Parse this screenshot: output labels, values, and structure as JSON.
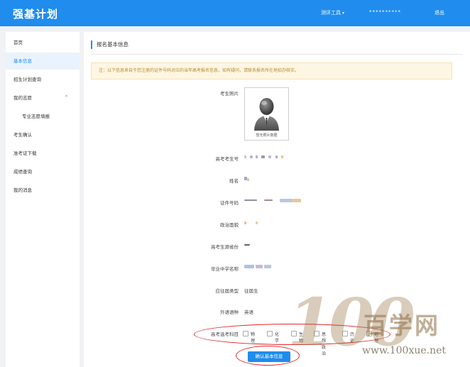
{
  "header": {
    "brand": "强基计划",
    "tools_menu": "测评工具",
    "username": "**********",
    "logout": "退出",
    "bar_color": "#1f8cee"
  },
  "sidebar": {
    "items": [
      {
        "label": "首页"
      },
      {
        "label": "基本信息",
        "active": true
      },
      {
        "label": "招生计划查询"
      },
      {
        "label": "我的志愿"
      },
      {
        "label": "专业志愿填报"
      },
      {
        "label": "考生确认"
      },
      {
        "label": "准考证下载"
      },
      {
        "label": "成绩查询"
      },
      {
        "label": "我的消息"
      }
    ]
  },
  "main": {
    "section_title": "报名基本信息",
    "notice": "注：以下信息来自于您注册的证件号码对应的当年高考报名信息，如有疑问，请联系报名所在地招办核实。",
    "photo": {
      "label": "考生照片",
      "caption": "暂无照片数据",
      "icon": "user-avatar-icon"
    },
    "fields": [
      {
        "label": "高考考生号"
      },
      {
        "label": "姓名"
      },
      {
        "label": "证件号码"
      },
      {
        "label": "政治面貌"
      },
      {
        "label": "高考生源省份"
      },
      {
        "label": "毕业中学名称"
      },
      {
        "label": "应往届类型",
        "value": "往届生"
      },
      {
        "label": "外语语种",
        "value": "英语"
      }
    ],
    "subjects": {
      "label": "高考选考科目",
      "options": [
        "物理",
        "化学",
        "生物",
        "思想政治",
        "历史",
        "地理"
      ]
    },
    "confirm_button": "确认基本信息"
  },
  "watermark": {
    "logo_number": "100",
    "site_name": "百学网",
    "url": "www.100xue.net"
  }
}
